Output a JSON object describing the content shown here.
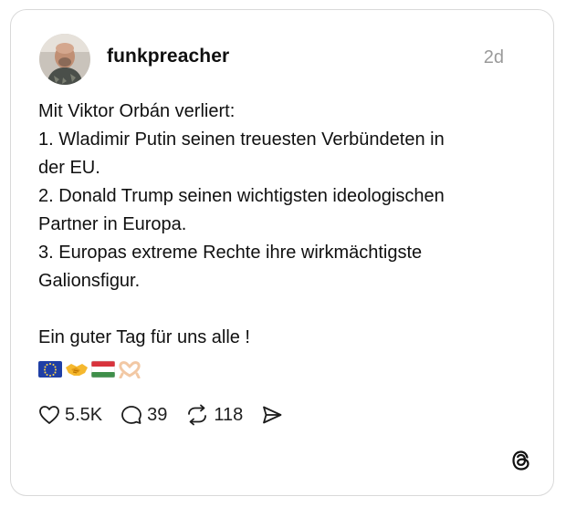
{
  "post": {
    "username": "funkpreacher",
    "timestamp": "2d",
    "lines": [
      "Mit Viktor Orbán verliert:",
      "1. Wladimir Putin seinen treuesten Verbündeten in",
      "der EU.",
      "2. Donald Trump seinen wichtigsten ideologischen",
      "Partner in Europa.",
      "3. Europas extreme Rechte ihre wirkmächtigste",
      "Galionsfigur.",
      "",
      "Ein guter Tag für uns alle !"
    ],
    "emojis": [
      "eu-flag",
      "handshake",
      "hungary-flag",
      "heart-hands"
    ]
  },
  "actions": {
    "likes": "5.5K",
    "replies": "39",
    "reposts": "118"
  },
  "icons": {
    "like": "heart-icon",
    "reply": "comment-icon",
    "repost": "repost-icon",
    "share": "share-icon",
    "brand": "threads-logo-icon"
  },
  "colors": {
    "text": "#101010",
    "muted": "#9a9a9a",
    "border": "#d9d9d9"
  }
}
